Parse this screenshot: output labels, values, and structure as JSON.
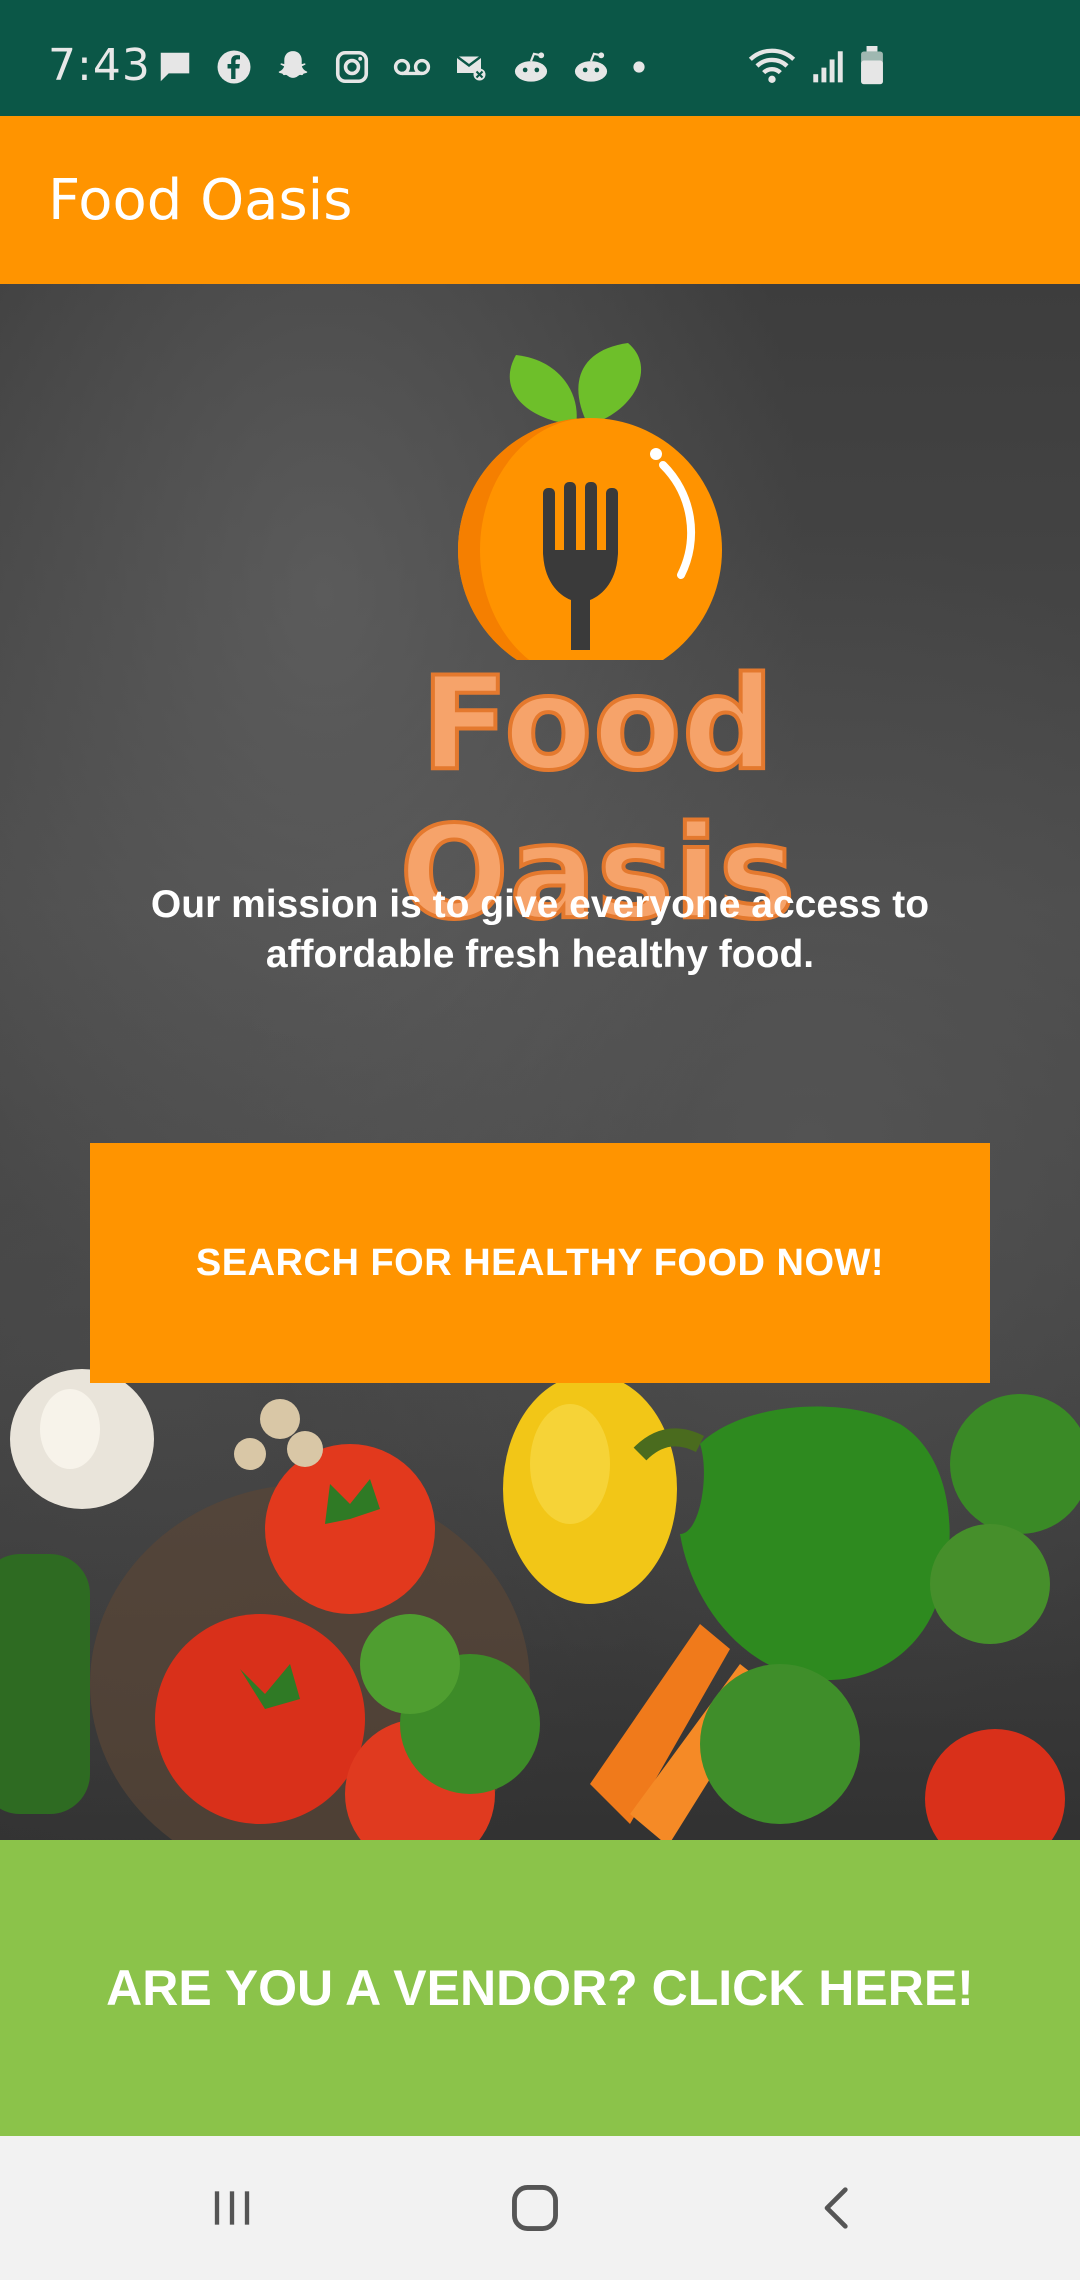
{
  "status_bar": {
    "time": "7:43",
    "notification_icons": [
      "message-icon",
      "facebook-icon",
      "snapchat-icon",
      "instagram-icon",
      "voicemail-icon",
      "missed-call-icon",
      "reddit-icon",
      "reddit-icon",
      "dot-icon"
    ],
    "system_icons": [
      "wifi-icon",
      "signal-icon",
      "battery-icon"
    ]
  },
  "app_bar": {
    "title": "Food Oasis"
  },
  "hero": {
    "logo_text": "Food Oasis",
    "mission": "Our mission is to give everyone access to affordable fresh healthy food.",
    "search_button_label": "SEARCH FOR HEALTHY FOOD NOW!"
  },
  "vendor": {
    "button_label": "ARE YOU A VENDOR? CLICK HERE!"
  },
  "nav_bar": {
    "buttons": [
      "recents-icon",
      "home-icon",
      "back-icon"
    ]
  },
  "colors": {
    "status_bar": "#0b5747",
    "app_bar": "#ff9400",
    "search_button": "#ff9400",
    "vendor_button": "#8bc34a",
    "logo_orange": "#ff9300",
    "logo_leaf": "#6ebf2a"
  }
}
